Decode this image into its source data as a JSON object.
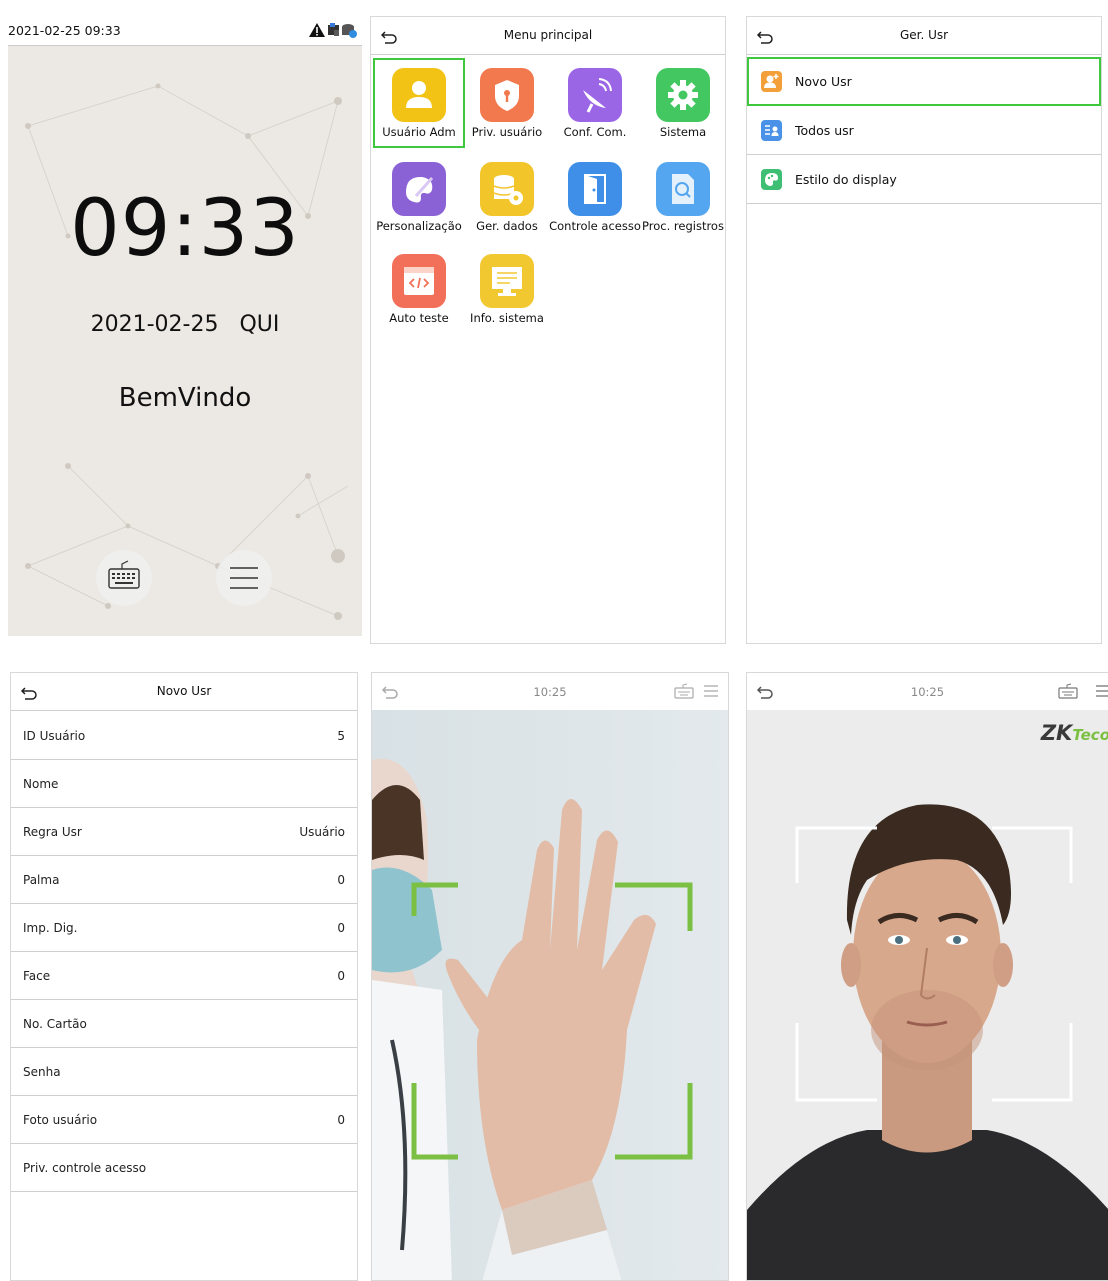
{
  "standby": {
    "status_datetime": "2021-02-25 09:33",
    "clock": "09:33",
    "date": "2021-02-25",
    "weekday": "QUI",
    "welcome": "BemVindo",
    "icons": [
      "warning-icon",
      "network-icon",
      "database-icon",
      "keyboard-icon",
      "menu-icon"
    ]
  },
  "main_menu": {
    "title": "Menu principal",
    "items": [
      {
        "label": "Usuário Adm",
        "icon": "user-admin-icon",
        "color": "#f2c314",
        "selected": true
      },
      {
        "label": "Priv. usuário",
        "icon": "shield-icon",
        "color": "#f2794d"
      },
      {
        "label": "Conf. Com.",
        "icon": "satellite-dish-icon",
        "color": "#9a66e6"
      },
      {
        "label": "Sistema",
        "icon": "gear-icon",
        "color": "#43c760"
      },
      {
        "label": "Personalização",
        "icon": "palette-icon",
        "color": "#8b62d6"
      },
      {
        "label": "Ger. dados",
        "icon": "database-gear-icon",
        "color": "#f2c52a"
      },
      {
        "label": "Controle acesso",
        "icon": "door-icon",
        "color": "#3f8fe8"
      },
      {
        "label": "Proc. registros",
        "icon": "search-doc-icon",
        "color": "#55a6f0"
      },
      {
        "label": "Auto teste",
        "icon": "code-window-icon",
        "color": "#f2705a"
      },
      {
        "label": "Info. sistema",
        "icon": "monitor-icon",
        "color": "#f2c830"
      }
    ]
  },
  "user_mgmt": {
    "title": "Ger. Usr",
    "items": [
      {
        "label": "Novo Usr",
        "icon": "add-user-icon",
        "color": "#f3a03a",
        "selected": true
      },
      {
        "label": "Todos usr",
        "icon": "user-list-icon",
        "color": "#4a92e8"
      },
      {
        "label": "Estilo do display",
        "icon": "palette-icon",
        "color": "#3fbf73"
      }
    ]
  },
  "new_user": {
    "title": "Novo Usr",
    "fields": [
      {
        "key": "ID Usuário",
        "value": "5"
      },
      {
        "key": "Nome",
        "value": ""
      },
      {
        "key": "Regra Usr",
        "value": "Usuário"
      },
      {
        "key": "Palma",
        "value": "0"
      },
      {
        "key": "Imp. Dig.",
        "value": "0"
      },
      {
        "key": "Face",
        "value": "0"
      },
      {
        "key": "No. Cartão",
        "value": ""
      },
      {
        "key": "Senha",
        "value": ""
      },
      {
        "key": "Foto usuário",
        "value": "0"
      },
      {
        "key": "Priv. controle acesso",
        "value": ""
      }
    ]
  },
  "palm_screen": {
    "time": "10:25",
    "frame_color": "#7bc043"
  },
  "face_screen": {
    "time": "10:25",
    "brand": "ZKTeco",
    "frame_color": "#ffffff"
  },
  "colors": {
    "accent": "#3ec83e"
  }
}
